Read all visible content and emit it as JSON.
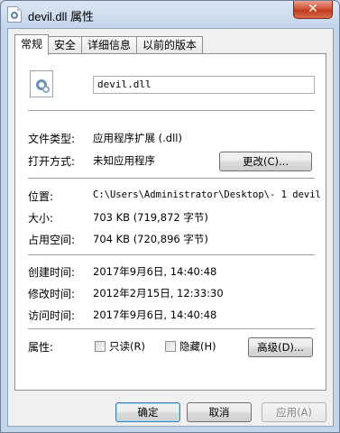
{
  "window": {
    "title": "devil.dll 属性",
    "close_label": "✕"
  },
  "tabs": [
    "常规",
    "安全",
    "详细信息",
    "以前的版本"
  ],
  "general": {
    "file_name": "devil.dll",
    "file_type_label": "文件类型:",
    "file_type_value": "应用程序扩展 (.dll)",
    "open_with_label": "打开方式:",
    "open_with_value": "未知应用程序",
    "change_button": "更改(C)...",
    "location_label": "位置:",
    "location_value": "C:\\Users\\Administrator\\Desktop\\- 1 devil",
    "size_label": "大小:",
    "size_value": "703 KB (719,872 字节)",
    "size_on_disk_label": "占用空间:",
    "size_on_disk_value": "704 KB (720,896 字节)",
    "created_label": "创建时间:",
    "created_value": "2017年9月6日, 14:40:48",
    "modified_label": "修改时间:",
    "modified_value": "2012年2月15日, 12:33:30",
    "accessed_label": "访问时间:",
    "accessed_value": "2017年9月6日, 14:40:48",
    "attributes_label": "属性:",
    "readonly_label": "只读(R)",
    "hidden_label": "隐藏(H)",
    "advanced_button": "高级(D)..."
  },
  "footer": {
    "ok": "确定",
    "cancel": "取消",
    "apply": "应用(A)"
  }
}
